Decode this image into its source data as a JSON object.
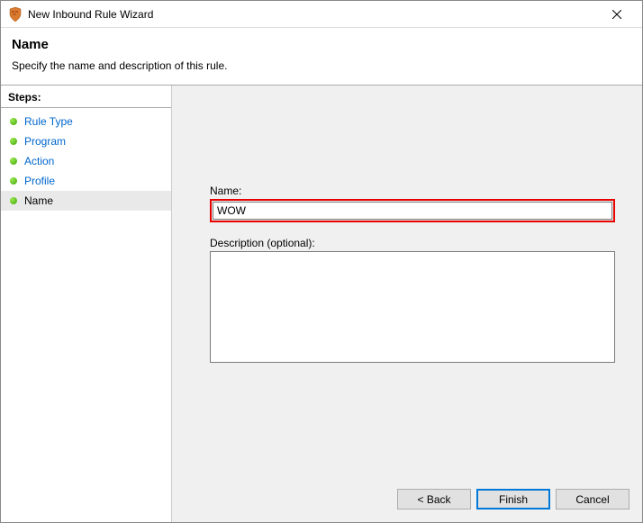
{
  "window": {
    "title": "New Inbound Rule Wizard"
  },
  "header": {
    "title": "Name",
    "subtitle": "Specify the name and description of this rule."
  },
  "sidebar": {
    "steps_label": "Steps:",
    "items": [
      {
        "label": "Rule Type",
        "current": false
      },
      {
        "label": "Program",
        "current": false
      },
      {
        "label": "Action",
        "current": false
      },
      {
        "label": "Profile",
        "current": false
      },
      {
        "label": "Name",
        "current": true
      }
    ]
  },
  "form": {
    "name_label": "Name:",
    "name_value": "WOW",
    "desc_label": "Description (optional):",
    "desc_value": ""
  },
  "buttons": {
    "back": "< Back",
    "finish": "Finish",
    "cancel": "Cancel"
  }
}
